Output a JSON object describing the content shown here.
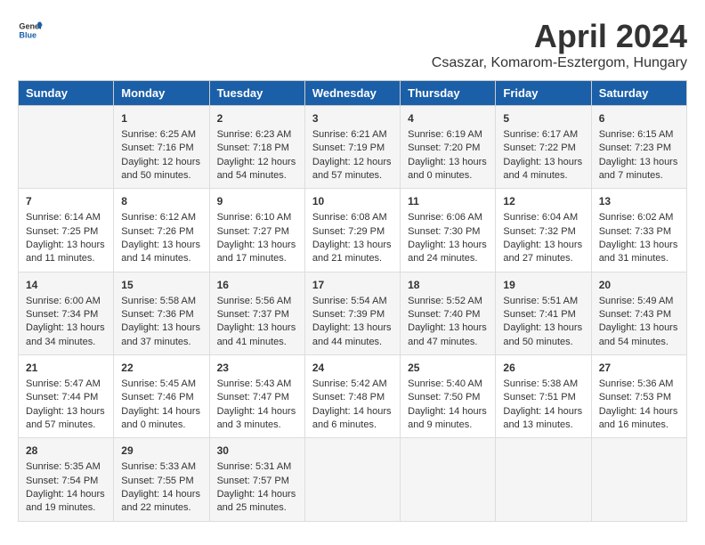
{
  "header": {
    "logo_general": "General",
    "logo_blue": "Blue",
    "title": "April 2024",
    "subtitle": "Csaszar, Komarom-Esztergom, Hungary"
  },
  "calendar": {
    "days_of_week": [
      "Sunday",
      "Monday",
      "Tuesday",
      "Wednesday",
      "Thursday",
      "Friday",
      "Saturday"
    ],
    "weeks": [
      [
        {
          "day": "",
          "info": ""
        },
        {
          "day": "1",
          "info": "Sunrise: 6:25 AM\nSunset: 7:16 PM\nDaylight: 12 hours\nand 50 minutes."
        },
        {
          "day": "2",
          "info": "Sunrise: 6:23 AM\nSunset: 7:18 PM\nDaylight: 12 hours\nand 54 minutes."
        },
        {
          "day": "3",
          "info": "Sunrise: 6:21 AM\nSunset: 7:19 PM\nDaylight: 12 hours\nand 57 minutes."
        },
        {
          "day": "4",
          "info": "Sunrise: 6:19 AM\nSunset: 7:20 PM\nDaylight: 13 hours\nand 0 minutes."
        },
        {
          "day": "5",
          "info": "Sunrise: 6:17 AM\nSunset: 7:22 PM\nDaylight: 13 hours\nand 4 minutes."
        },
        {
          "day": "6",
          "info": "Sunrise: 6:15 AM\nSunset: 7:23 PM\nDaylight: 13 hours\nand 7 minutes."
        }
      ],
      [
        {
          "day": "7",
          "info": "Sunrise: 6:14 AM\nSunset: 7:25 PM\nDaylight: 13 hours\nand 11 minutes."
        },
        {
          "day": "8",
          "info": "Sunrise: 6:12 AM\nSunset: 7:26 PM\nDaylight: 13 hours\nand 14 minutes."
        },
        {
          "day": "9",
          "info": "Sunrise: 6:10 AM\nSunset: 7:27 PM\nDaylight: 13 hours\nand 17 minutes."
        },
        {
          "day": "10",
          "info": "Sunrise: 6:08 AM\nSunset: 7:29 PM\nDaylight: 13 hours\nand 21 minutes."
        },
        {
          "day": "11",
          "info": "Sunrise: 6:06 AM\nSunset: 7:30 PM\nDaylight: 13 hours\nand 24 minutes."
        },
        {
          "day": "12",
          "info": "Sunrise: 6:04 AM\nSunset: 7:32 PM\nDaylight: 13 hours\nand 27 minutes."
        },
        {
          "day": "13",
          "info": "Sunrise: 6:02 AM\nSunset: 7:33 PM\nDaylight: 13 hours\nand 31 minutes."
        }
      ],
      [
        {
          "day": "14",
          "info": "Sunrise: 6:00 AM\nSunset: 7:34 PM\nDaylight: 13 hours\nand 34 minutes."
        },
        {
          "day": "15",
          "info": "Sunrise: 5:58 AM\nSunset: 7:36 PM\nDaylight: 13 hours\nand 37 minutes."
        },
        {
          "day": "16",
          "info": "Sunrise: 5:56 AM\nSunset: 7:37 PM\nDaylight: 13 hours\nand 41 minutes."
        },
        {
          "day": "17",
          "info": "Sunrise: 5:54 AM\nSunset: 7:39 PM\nDaylight: 13 hours\nand 44 minutes."
        },
        {
          "day": "18",
          "info": "Sunrise: 5:52 AM\nSunset: 7:40 PM\nDaylight: 13 hours\nand 47 minutes."
        },
        {
          "day": "19",
          "info": "Sunrise: 5:51 AM\nSunset: 7:41 PM\nDaylight: 13 hours\nand 50 minutes."
        },
        {
          "day": "20",
          "info": "Sunrise: 5:49 AM\nSunset: 7:43 PM\nDaylight: 13 hours\nand 54 minutes."
        }
      ],
      [
        {
          "day": "21",
          "info": "Sunrise: 5:47 AM\nSunset: 7:44 PM\nDaylight: 13 hours\nand 57 minutes."
        },
        {
          "day": "22",
          "info": "Sunrise: 5:45 AM\nSunset: 7:46 PM\nDaylight: 14 hours\nand 0 minutes."
        },
        {
          "day": "23",
          "info": "Sunrise: 5:43 AM\nSunset: 7:47 PM\nDaylight: 14 hours\nand 3 minutes."
        },
        {
          "day": "24",
          "info": "Sunrise: 5:42 AM\nSunset: 7:48 PM\nDaylight: 14 hours\nand 6 minutes."
        },
        {
          "day": "25",
          "info": "Sunrise: 5:40 AM\nSunset: 7:50 PM\nDaylight: 14 hours\nand 9 minutes."
        },
        {
          "day": "26",
          "info": "Sunrise: 5:38 AM\nSunset: 7:51 PM\nDaylight: 14 hours\nand 13 minutes."
        },
        {
          "day": "27",
          "info": "Sunrise: 5:36 AM\nSunset: 7:53 PM\nDaylight: 14 hours\nand 16 minutes."
        }
      ],
      [
        {
          "day": "28",
          "info": "Sunrise: 5:35 AM\nSunset: 7:54 PM\nDaylight: 14 hours\nand 19 minutes."
        },
        {
          "day": "29",
          "info": "Sunrise: 5:33 AM\nSunset: 7:55 PM\nDaylight: 14 hours\nand 22 minutes."
        },
        {
          "day": "30",
          "info": "Sunrise: 5:31 AM\nSunset: 7:57 PM\nDaylight: 14 hours\nand 25 minutes."
        },
        {
          "day": "",
          "info": ""
        },
        {
          "day": "",
          "info": ""
        },
        {
          "day": "",
          "info": ""
        },
        {
          "day": "",
          "info": ""
        }
      ]
    ]
  }
}
